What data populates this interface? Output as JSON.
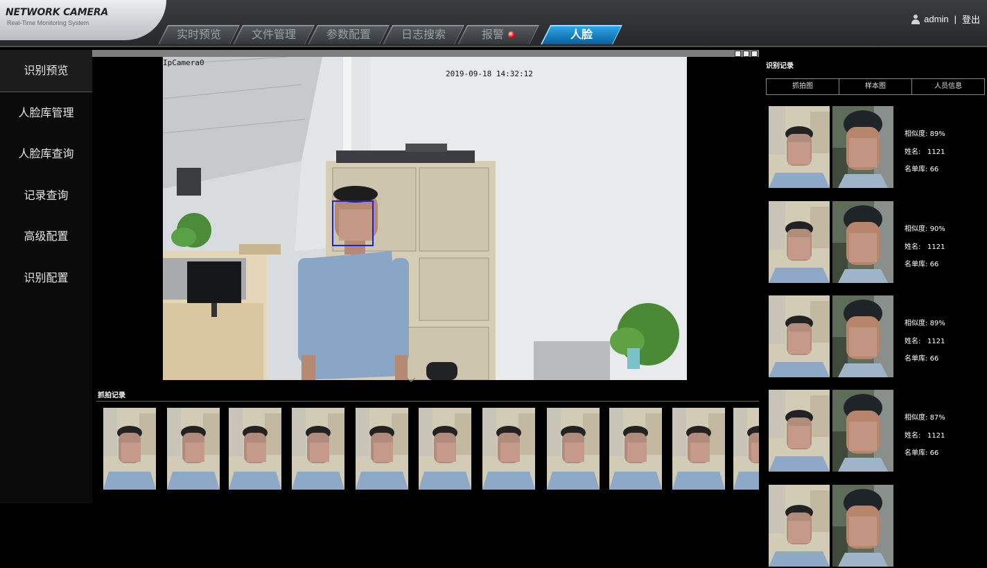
{
  "header": {
    "logo_title": "NETWORK CAMERA",
    "logo_subtitle": "Real-Time Monitoring System",
    "tabs": [
      {
        "label": "实时预览",
        "active": false
      },
      {
        "label": "文件管理",
        "active": false
      },
      {
        "label": "参数配置",
        "active": false
      },
      {
        "label": "日志搜索",
        "active": false
      },
      {
        "label": "报警",
        "active": false,
        "has_alarm_indicator": true
      },
      {
        "label": "人脸",
        "active": true
      }
    ],
    "user": {
      "name": "admin",
      "separator": "|",
      "logout": "登出",
      "icon": "user-icon"
    }
  },
  "sidebar": {
    "items": [
      {
        "label": "识别预览",
        "active": true
      },
      {
        "label": "人脸库管理",
        "active": false
      },
      {
        "label": "人脸库查询",
        "active": false
      },
      {
        "label": "记录查询",
        "active": false
      },
      {
        "label": "高级配置",
        "active": false
      },
      {
        "label": "识别配置",
        "active": false
      }
    ]
  },
  "video": {
    "camera_name": "IpCamera0",
    "timestamp": "2019-09-18 14:32:12",
    "face_box_color": "#1a21e6"
  },
  "capture": {
    "title": "抓拍记录",
    "thumb_count": 11
  },
  "recognition": {
    "title": "识别记录",
    "headers": [
      "抓拍图",
      "样本图",
      "人员信息"
    ],
    "labels": {
      "similarity": "相似度:",
      "name": "姓名:",
      "library": "名单库:"
    },
    "records": [
      {
        "similarity": "89%",
        "name": "1121",
        "library": "66"
      },
      {
        "similarity": "90%",
        "name": "1121",
        "library": "66"
      },
      {
        "similarity": "89%",
        "name": "1121",
        "library": "66"
      },
      {
        "similarity": "87%",
        "name": "1121",
        "library": "66"
      }
    ]
  },
  "colors": {
    "accent": "#1a8fd6",
    "alarm": "#e8121a",
    "header_bg": "#2f3235"
  }
}
